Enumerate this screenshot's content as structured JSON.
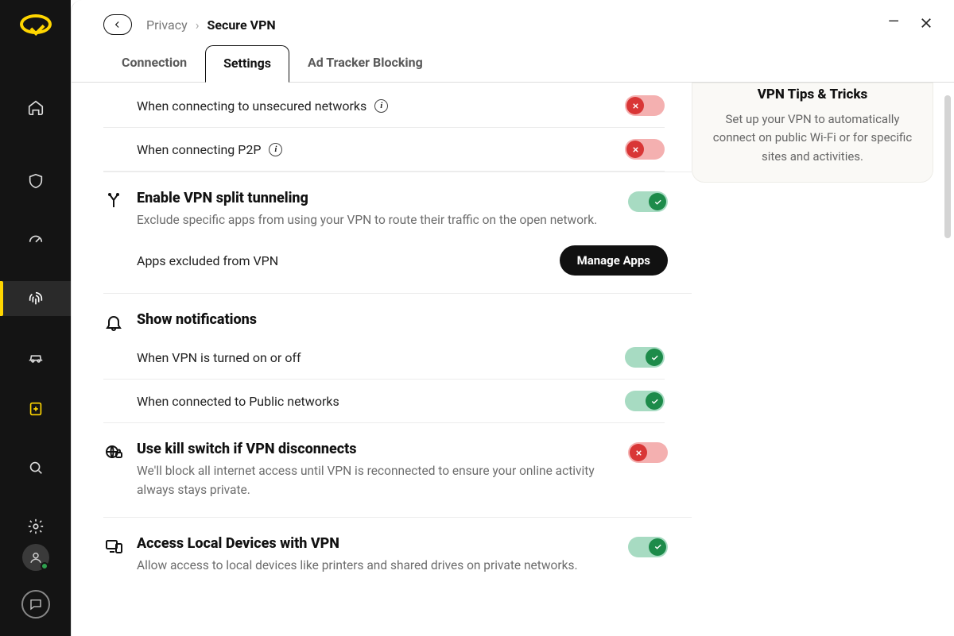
{
  "breadcrumb": {
    "root": "Privacy",
    "current": "Secure VPN"
  },
  "tabs": {
    "connection": "Connection",
    "settings": "Settings",
    "adtracker": "Ad Tracker Blocking"
  },
  "tips": {
    "title": "VPN Tips & Tricks",
    "body": "Set up your VPN to automatically connect on public Wi-Fi or for specific sites and activities."
  },
  "rows": {
    "unsecured": "When connecting to unsecured networks",
    "p2p": "When connecting P2P"
  },
  "split": {
    "title": "Enable VPN split tunneling",
    "desc": "Exclude specific apps from using your VPN to route their traffic on the open network.",
    "exclLabel": "Apps excluded from VPN",
    "manage": "Manage Apps"
  },
  "notif": {
    "title": "Show notifications",
    "onoff": "When VPN is turned on or off",
    "public": "When connected to Public networks"
  },
  "kill": {
    "title": "Use kill switch if VPN disconnects",
    "desc": "We'll block all internet access until VPN is reconnected to ensure your online activity always stays private."
  },
  "local": {
    "title": "Access Local Devices with VPN",
    "desc": "Allow access to local devices like printers and shared drives on private networks."
  }
}
